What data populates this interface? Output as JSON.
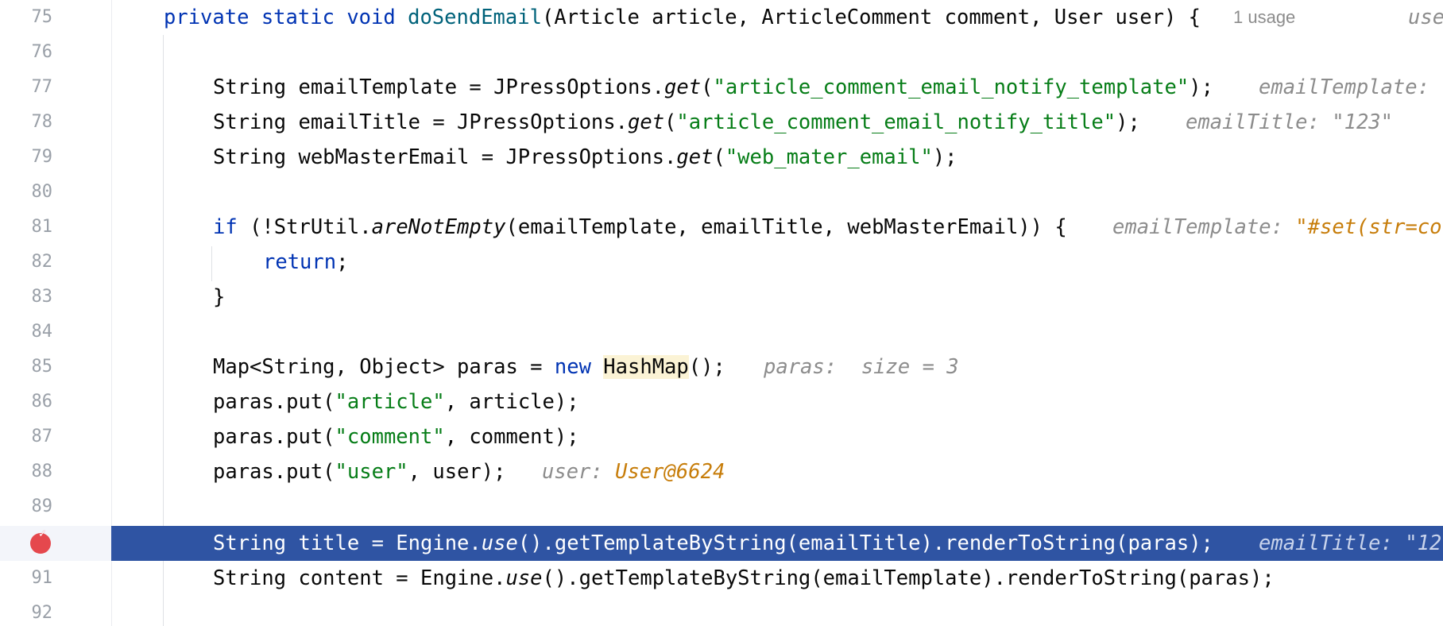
{
  "editor": {
    "lines": [
      {
        "num": "75",
        "code": "private static void doSendEmail(Article article, ArticleComment comment, User user) {",
        "usage": "1 usage",
        "author": "use"
      },
      {
        "num": "76",
        "code": ""
      },
      {
        "num": "77",
        "code": "String emailTemplate = JPressOptions.get(\"article_comment_email_notify_template\");",
        "hint_label": "emailTemplate:"
      },
      {
        "num": "78",
        "code": "String emailTitle = JPressOptions.get(\"article_comment_email_notify_title\");",
        "hint_label": "emailTitle:",
        "hint_value": "\"123\""
      },
      {
        "num": "79",
        "code": "String webMasterEmail = JPressOptions.get(\"web_mater_email\");"
      },
      {
        "num": "80",
        "code": ""
      },
      {
        "num": "81",
        "code": "if (!StrUtil.areNotEmpty(emailTemplate, emailTitle, webMasterEmail)) {",
        "hint_label": "emailTemplate:",
        "hint_value": "\"#set(str=co"
      },
      {
        "num": "82",
        "code": "return;"
      },
      {
        "num": "83",
        "code": "}"
      },
      {
        "num": "84",
        "code": ""
      },
      {
        "num": "85",
        "code": "Map<String, Object> paras = new HashMap();",
        "hint_label": "paras:  size = 3"
      },
      {
        "num": "86",
        "code": "paras.put(\"article\", article);"
      },
      {
        "num": "87",
        "code": "paras.put(\"comment\", comment);"
      },
      {
        "num": "88",
        "code": "paras.put(\"user\", user);",
        "hint_label": "user:",
        "hint_value": "User@6624"
      },
      {
        "num": "89",
        "code": ""
      },
      {
        "num": "90",
        "code": "String title = Engine.use().getTemplateByString(emailTitle).renderToString(paras);",
        "hint_label": "emailTitle: \"12",
        "current": true
      },
      {
        "num": "91",
        "code": "String content = Engine.use().getTemplateByString(emailTemplate).renderToString(paras);"
      },
      {
        "num": "92",
        "code": ""
      }
    ],
    "colors": {
      "current_line": "#2f54a3",
      "keyword": "#0033b3",
      "string": "#067d17",
      "method_decl": "#00627a",
      "hint": "#8c8c8c",
      "hint_value": "#c77d0a",
      "breakpoint": "#e5484d"
    },
    "breakpoint": {
      "line": "90",
      "icon": "breakpoint-icon"
    }
  }
}
